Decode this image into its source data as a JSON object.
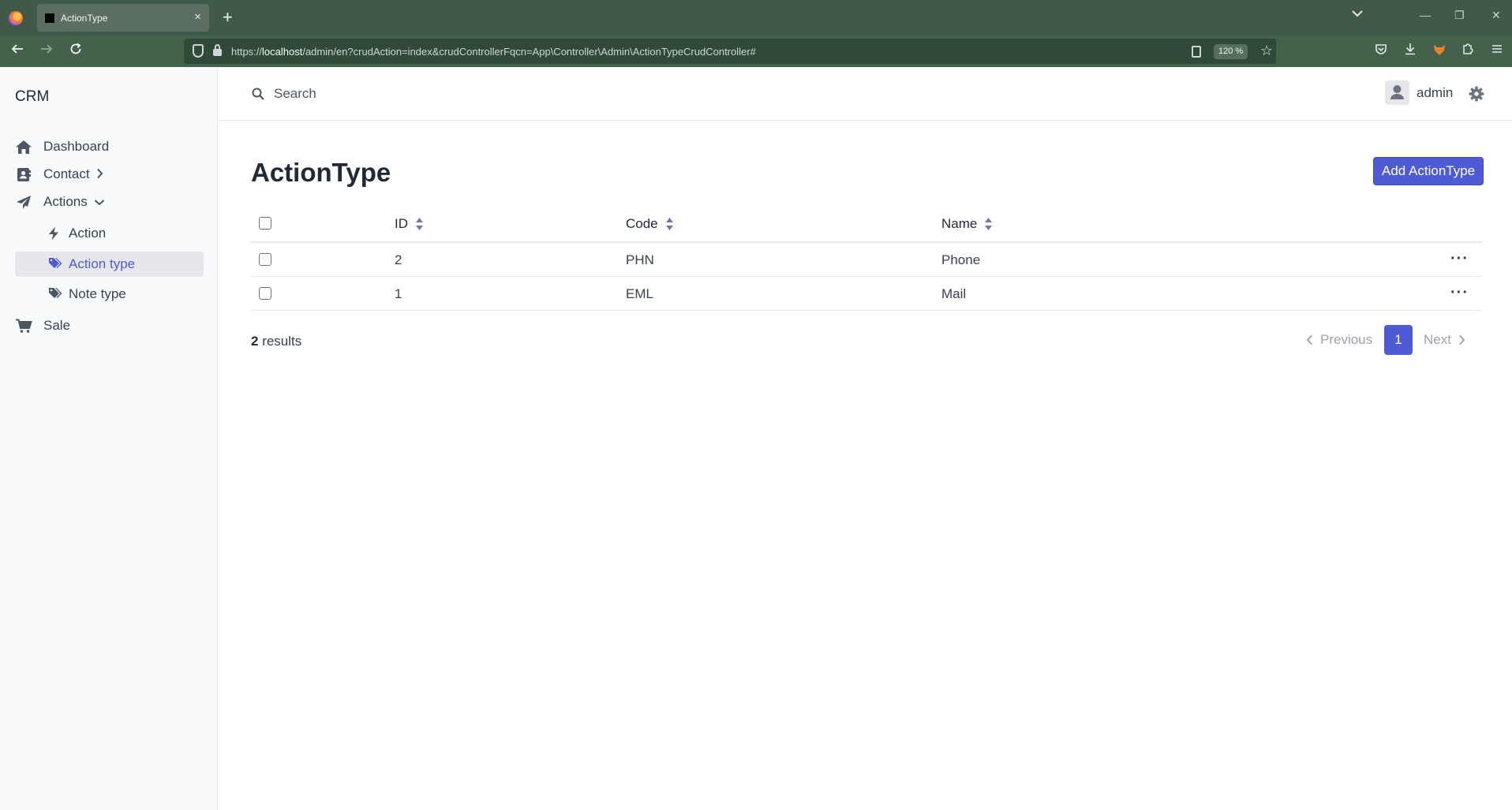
{
  "browser": {
    "tab_title": "ActionType",
    "url_prefix": "https://",
    "url_host": "localhost",
    "url_path": "/admin/en?crudAction=index&crudControllerFqcn=App\\Controller\\Admin\\ActionTypeCrudController#",
    "zoom": "120 %"
  },
  "sidebar": {
    "brand": "CRM",
    "items": [
      {
        "label": "Dashboard",
        "icon": "home-icon"
      },
      {
        "label": "Contact",
        "icon": "contact-card-icon"
      },
      {
        "label": "Actions",
        "icon": "paper-plane-icon"
      },
      {
        "label": "Sale",
        "icon": "shopping-cart-icon"
      }
    ],
    "subitems": [
      {
        "label": "Action",
        "icon": "bolt-icon"
      },
      {
        "label": "Action type",
        "icon": "tags-icon",
        "active": true
      },
      {
        "label": "Note type",
        "icon": "tags-icon"
      }
    ]
  },
  "header": {
    "search_placeholder": "Search",
    "username": "admin"
  },
  "main": {
    "title": "ActionType",
    "add_button": "Add ActionType",
    "columns": [
      "ID",
      "Code",
      "Name"
    ],
    "rows": [
      {
        "id": "2",
        "code": "PHN",
        "name": "Phone"
      },
      {
        "id": "1",
        "code": "EML",
        "name": "Mail"
      }
    ],
    "results_count": "2",
    "results_label": " results",
    "pagination": {
      "previous": "Previous",
      "current": "1",
      "next": "Next"
    }
  },
  "colors": {
    "accent": "#4f5bd5",
    "browser_toolbar": "#44614c"
  }
}
